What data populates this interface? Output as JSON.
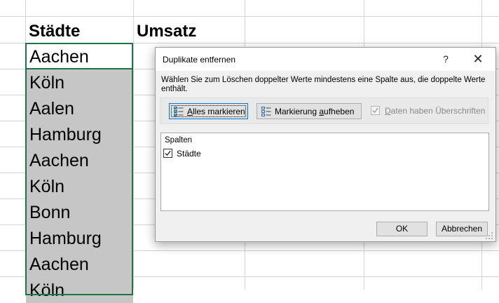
{
  "sheet": {
    "headers": {
      "col_a": "Städte",
      "col_b": "Umsatz"
    },
    "rows": [
      "Aachen",
      "Köln",
      "Aalen",
      "Hamburg",
      "Aachen",
      "Köln",
      "Bonn",
      "Hamburg",
      "Aachen",
      "Köln"
    ]
  },
  "dialog": {
    "title": "Duplikate entfernen",
    "help": "?",
    "close": "✕",
    "description": "Wählen Sie zum Löschen doppelter Werte mindestens eine Spalte aus, die doppelte Werte enthält.",
    "select_all": {
      "before": "",
      "accel": "A",
      "after": "lles markieren"
    },
    "unselect_all": {
      "before": "Markierung ",
      "accel": "a",
      "after": "ufheben"
    },
    "has_headers": {
      "before": "",
      "accel": "D",
      "after": "aten haben Überschriften",
      "checked": true,
      "enabled": false
    },
    "columns_header": "Spalten",
    "columns": [
      {
        "label": "Städte",
        "checked": true
      }
    ],
    "ok": "OK",
    "cancel": "Abbrechen"
  },
  "colors": {
    "selection_border": "#217346",
    "selected_fill": "#c6c6c6",
    "focus_border": "#0078d7"
  }
}
